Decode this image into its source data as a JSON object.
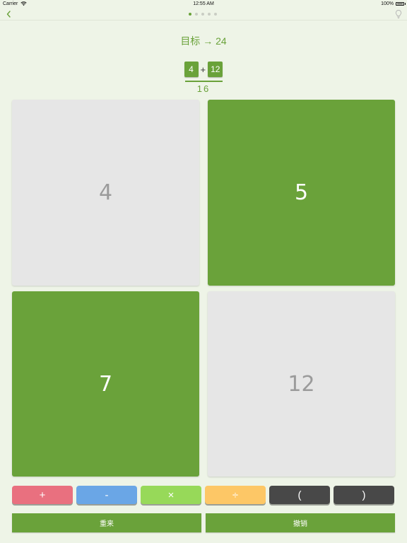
{
  "status_bar": {
    "carrier": "Carrier",
    "time": "12:55 AM",
    "battery": "100%"
  },
  "nav": {
    "back_icon": "chevron-left-icon",
    "hint_icon": "lightbulb-icon",
    "page_count": 5,
    "active_page": 1
  },
  "goal": {
    "text": "目标 → 24"
  },
  "expression": {
    "left": "4",
    "operator": "+",
    "right": "12",
    "result": "16"
  },
  "cards": [
    {
      "value": "4",
      "state": "used"
    },
    {
      "value": "5",
      "state": "available"
    },
    {
      "value": "7",
      "state": "available"
    },
    {
      "value": "12",
      "state": "used"
    }
  ],
  "operators": [
    {
      "label": "+",
      "color": "#e9707f"
    },
    {
      "label": "-",
      "color": "#6aa6e6"
    },
    {
      "label": "×",
      "color": "#97d959"
    },
    {
      "label": "÷",
      "color": "#fdc766"
    },
    {
      "label": "(",
      "color": "#484848"
    },
    {
      "label": ")",
      "color": "#484848"
    }
  ],
  "actions": {
    "reset": "重来",
    "undo": "撤销"
  },
  "colors": {
    "accent": "#6aa23a",
    "background": "#eef4e7",
    "card_used": "#e6e6e6"
  }
}
